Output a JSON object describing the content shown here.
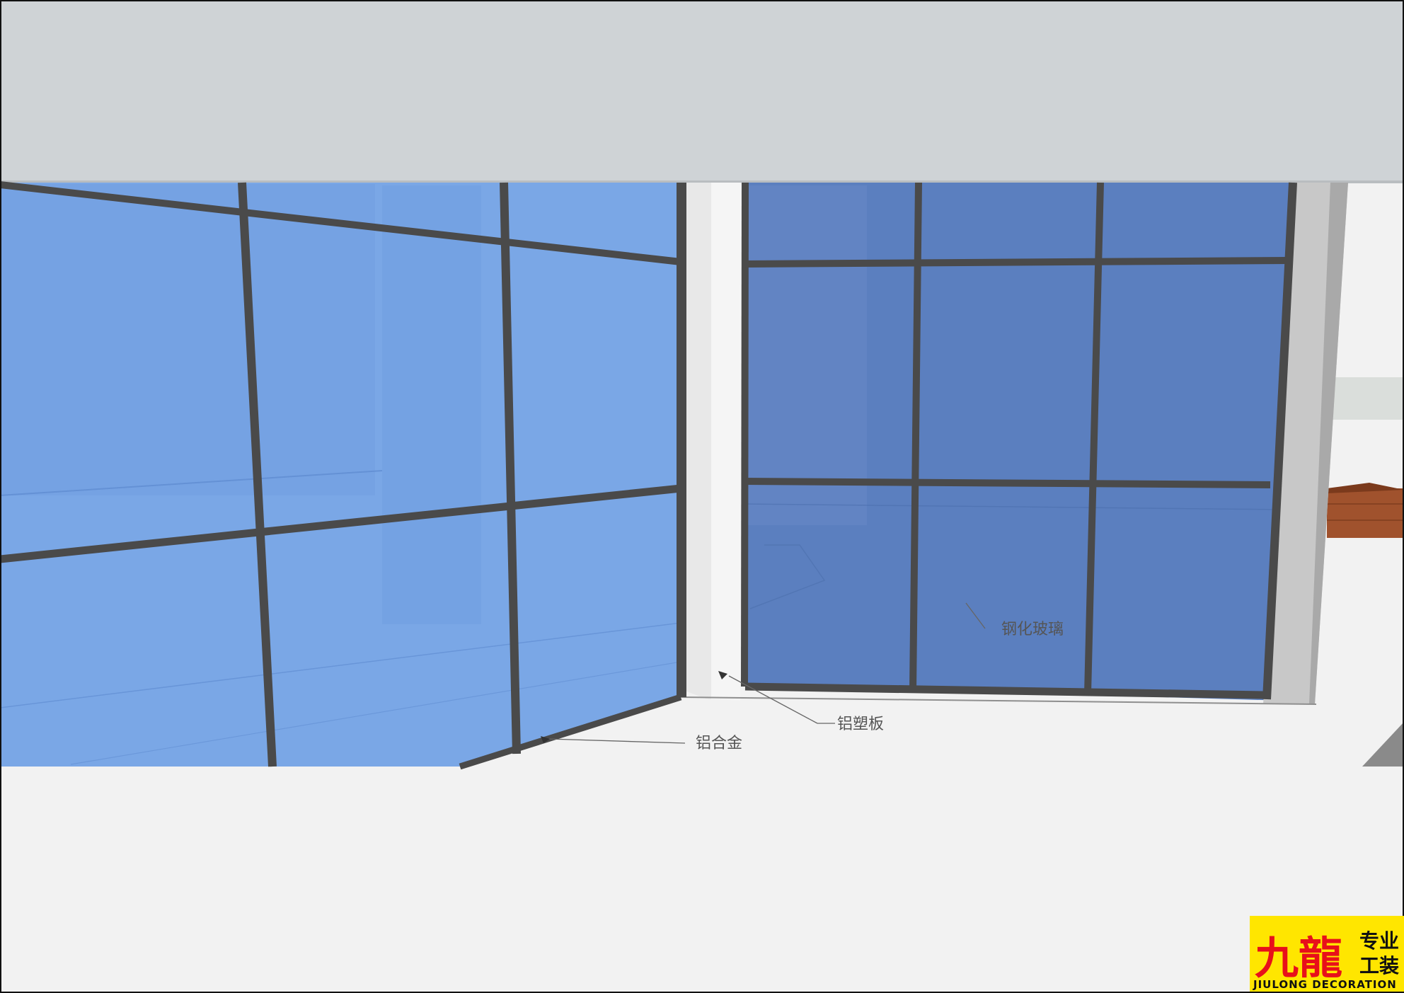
{
  "annotations": {
    "glass": "钢化玻璃",
    "acp": "铝塑板",
    "aluminum": "铝合金"
  },
  "logo": {
    "name": "九龍",
    "tagline_top": "专业",
    "tagline_bottom": "工装",
    "english": "JIULONG DECORATION"
  },
  "colors": {
    "ceiling": "#cfd3d6",
    "floor": "#f2f2f2",
    "glass_left": "#7aa7e6",
    "glass_right": "#5b7fbf",
    "frame": "#4a4a4a",
    "column": "#e8e8e8",
    "brick": "#a0522d",
    "logo_bg": "#ffe600",
    "logo_red": "#e8101a"
  }
}
